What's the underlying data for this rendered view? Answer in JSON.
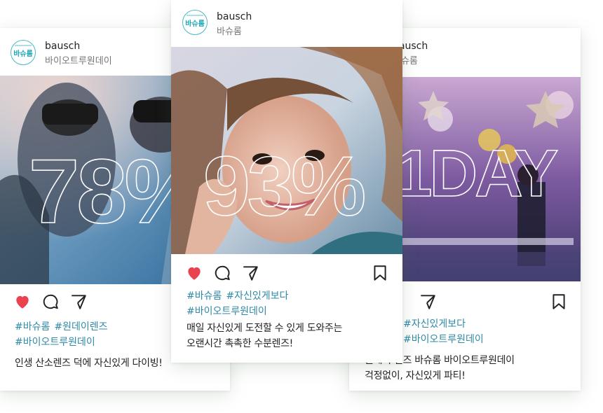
{
  "brand": {
    "avatar_text": "바슈롬",
    "accent": "#19a4b4",
    "hashtag_color": "#2f8aa8",
    "heart_color": "#e8434f"
  },
  "cards": [
    {
      "id": "left",
      "username": "bausch",
      "subtitle": "바이오트루원데이",
      "photo_text": "78%",
      "liked": true,
      "hashtags": [
        "#바슈롬",
        "#원데이렌즈",
        "#바이오트루원데이"
      ],
      "caption": [
        "인생 산소렌즈 덕에 자신있게 다이빙!"
      ]
    },
    {
      "id": "center",
      "username": "bausch",
      "subtitle": "바슈롬",
      "photo_text": "93%",
      "liked": true,
      "hashtags": [
        "#바슈롬",
        "#자신있게보다",
        "#바이오트루원데이"
      ],
      "caption": [
        "매일 자신있게 도전할 수 있게 도와주는",
        "오랜시간 촉촉한 수분렌즈!"
      ]
    },
    {
      "id": "right",
      "username": "bausch",
      "subtitle": "바슈롬",
      "photo_text": "1DAY",
      "liked": false,
      "hashtags": [
        "#자신있게보다",
        "#바이오트루원데이"
      ],
      "caption": [
        "원데이 렌즈 바슈롬 바이오트루원데이",
        "걱정없이, 자신있게 파티!"
      ]
    }
  ]
}
